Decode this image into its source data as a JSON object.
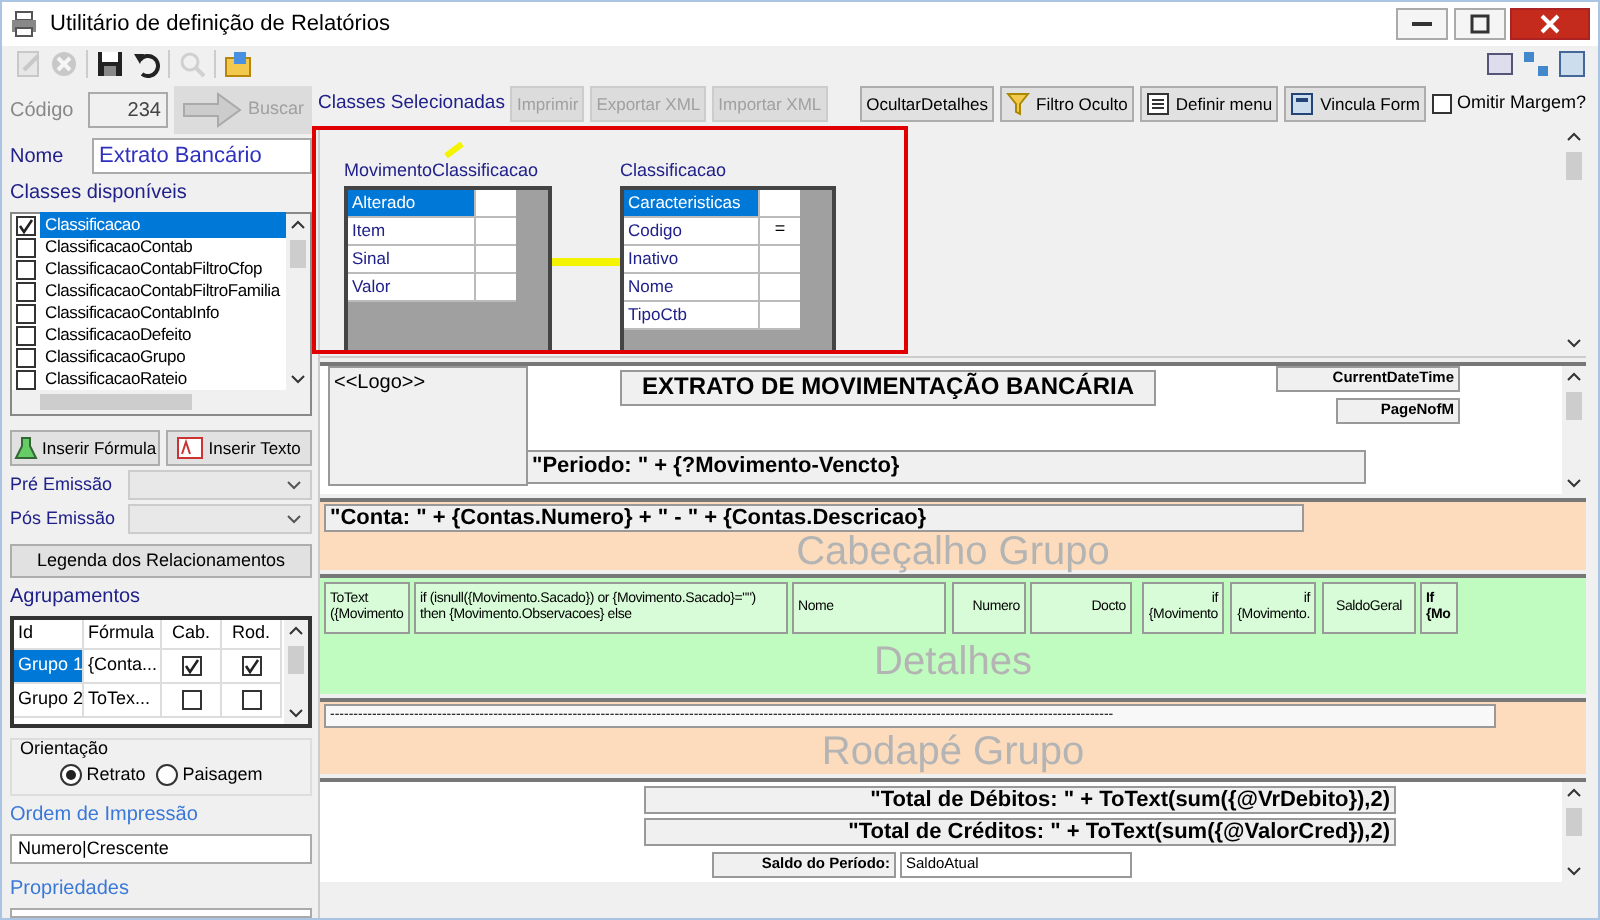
{
  "window": {
    "title": "Utilitário de definição de Relatórios"
  },
  "toolbar": [
    {
      "kind": "edit",
      "disabled": true
    },
    {
      "kind": "cancel",
      "disabled": true
    },
    {
      "kind": "save",
      "disabled": false
    },
    {
      "kind": "undo",
      "disabled": false
    },
    {
      "kind": "zoom",
      "disabled": true
    },
    {
      "kind": "folder",
      "disabled": false
    }
  ],
  "form": {
    "codigo": {
      "label": "Código",
      "value": "234",
      "disabled": true
    },
    "buscar": {
      "label": "Buscar",
      "disabled": true
    },
    "nome": {
      "label": "Nome",
      "value": "Extrato Bancário"
    }
  },
  "classes": {
    "label": "Classes disponíveis",
    "items": [
      {
        "label": "Classificacao",
        "checked": true,
        "selected": true
      },
      {
        "label": "ClassificacaoContab",
        "checked": false,
        "selected": false
      },
      {
        "label": "ClassificacaoContabFiltroCfop",
        "checked": false,
        "selected": false
      },
      {
        "label": "ClassificacaoContabFiltroFamilia",
        "checked": false,
        "selected": false
      },
      {
        "label": "ClassificacaoContabInfo",
        "checked": false,
        "selected": false
      },
      {
        "label": "ClassificacaoDefeito",
        "checked": false,
        "selected": false
      },
      {
        "label": "ClassificacaoGrupo",
        "checked": false,
        "selected": false
      },
      {
        "label": "ClassificacaoRateio",
        "checked": false,
        "selected": false
      }
    ]
  },
  "insert_buttons": [
    {
      "kind": "formula",
      "label": "Inserir Fórmula"
    },
    {
      "kind": "text",
      "label": "Inserir Texto"
    }
  ],
  "emissao": [
    {
      "label": "Pré Emissão"
    },
    {
      "label": "Pós Emissão"
    }
  ],
  "legend_button": "Legenda dos Relacionamentos",
  "agrupamentos": {
    "title": "Agrupamentos",
    "columns": [
      "Id",
      "Fórmula",
      "Cab.",
      "Rod."
    ],
    "rows": [
      {
        "id": "Grupo 1",
        "formula": "{Conta...",
        "cab": true,
        "rod": true,
        "selected": true
      },
      {
        "id": "Grupo 2",
        "formula": "ToTex...",
        "cab": false,
        "rod": false,
        "selected": false
      }
    ]
  },
  "orientacao": {
    "title": "Orientação",
    "options": [
      {
        "label": "Retrato",
        "selected": true
      },
      {
        "label": "Paisagem",
        "selected": false
      }
    ]
  },
  "ordem": {
    "label": "Ordem de Impressão",
    "value": "Numero|Crescente"
  },
  "propriedades": {
    "label": "Propriedades"
  },
  "top_bar": {
    "label": "Classes Selecionadas",
    "buttons": [
      {
        "kind": "plain",
        "label": "Imprimir",
        "disabled": true
      },
      {
        "kind": "plain",
        "label": "Exportar XML",
        "disabled": true
      },
      {
        "kind": "plain",
        "label": "Importar XML",
        "disabled": true
      },
      {
        "kind": "plain",
        "label": "OcultarDetalhes",
        "disabled": false
      },
      {
        "kind": "filter",
        "label": "Filtro Oculto",
        "disabled": false
      },
      {
        "kind": "menu",
        "label": "Definir menu",
        "disabled": false
      },
      {
        "kind": "form",
        "label": "Vincula Form",
        "disabled": false
      }
    ],
    "omitir": {
      "label": "Omitir Margem?",
      "checked": false
    }
  },
  "diagram": {
    "tables": [
      {
        "title": "MovimentoClassificacao",
        "fields": [
          {
            "name": "Alterado",
            "selected": true
          },
          {
            "name": "Item",
            "selected": false
          },
          {
            "name": "Sinal",
            "selected": false
          },
          {
            "name": "Valor",
            "selected": false
          }
        ]
      },
      {
        "title": "Classificacao",
        "fields": [
          {
            "name": "Caracteristicas",
            "selected": true
          },
          {
            "name": "Codigo",
            "selected": false,
            "marker": "="
          },
          {
            "name": "Inativo",
            "selected": false
          },
          {
            "name": "Nome",
            "selected": false
          },
          {
            "name": "TipoCtb",
            "selected": false
          }
        ]
      }
    ]
  },
  "report": {
    "bands": [
      {
        "kind": "page_header",
        "fields": [
          {
            "kind": "logo",
            "text": "<<Logo>>"
          },
          {
            "kind": "title",
            "text": "EXTRATO DE MOVIMENTAÇÃO BANCÁRIA"
          },
          {
            "kind": "meta",
            "text": "CurrentDateTime"
          },
          {
            "kind": "meta",
            "text": "PageNofM"
          },
          {
            "kind": "expression",
            "text": "\"Periodo: \" + {?Movimento-Vencto}"
          }
        ]
      },
      {
        "kind": "group_header",
        "label": "Cabeçalho Grupo",
        "fields": [
          {
            "kind": "expression",
            "text": "\"Conta: \" + {Contas.Numero} + \" - \" + {Contas.Descricao}"
          }
        ]
      },
      {
        "kind": "details",
        "label": "Detalhes",
        "fields": [
          {
            "kind": "cell",
            "text": "ToText ({Movimento"
          },
          {
            "kind": "cell",
            "text": "if (isnull({Movimento.Sacado}) or {Movimento.Sacado}=\"\") then {Movimento.Observacoes} else"
          },
          {
            "kind": "cell",
            "text": "Nome"
          },
          {
            "kind": "cell_right",
            "text": "Numero"
          },
          {
            "kind": "cell_right",
            "text": "Docto"
          },
          {
            "kind": "cell_right",
            "text": "if {Movimento"
          },
          {
            "kind": "cell_right",
            "text": "if {Movimento."
          },
          {
            "kind": "cell_center",
            "text": "SaldoGeral"
          },
          {
            "kind": "cell_bold",
            "text": "If {Mo"
          }
        ]
      },
      {
        "kind": "group_footer",
        "label": "Rodapé Grupo",
        "fields": [
          {
            "kind": "rule",
            "text": "------------------------------------------------------------------------------------------------------------------------------------------------------------------------"
          }
        ]
      },
      {
        "kind": "footer",
        "fields": [
          {
            "kind": "total",
            "text": "\"Total de Débitos: \" + ToText(sum({@VrDebito}),2)"
          },
          {
            "kind": "total",
            "text": "\"Total de Créditos: \" + ToText(sum({@ValorCred}),2)"
          },
          {
            "kind": "label_right",
            "text": "Saldo do Período:"
          },
          {
            "kind": "value",
            "text": "SaldoAtual"
          }
        ]
      }
    ]
  }
}
